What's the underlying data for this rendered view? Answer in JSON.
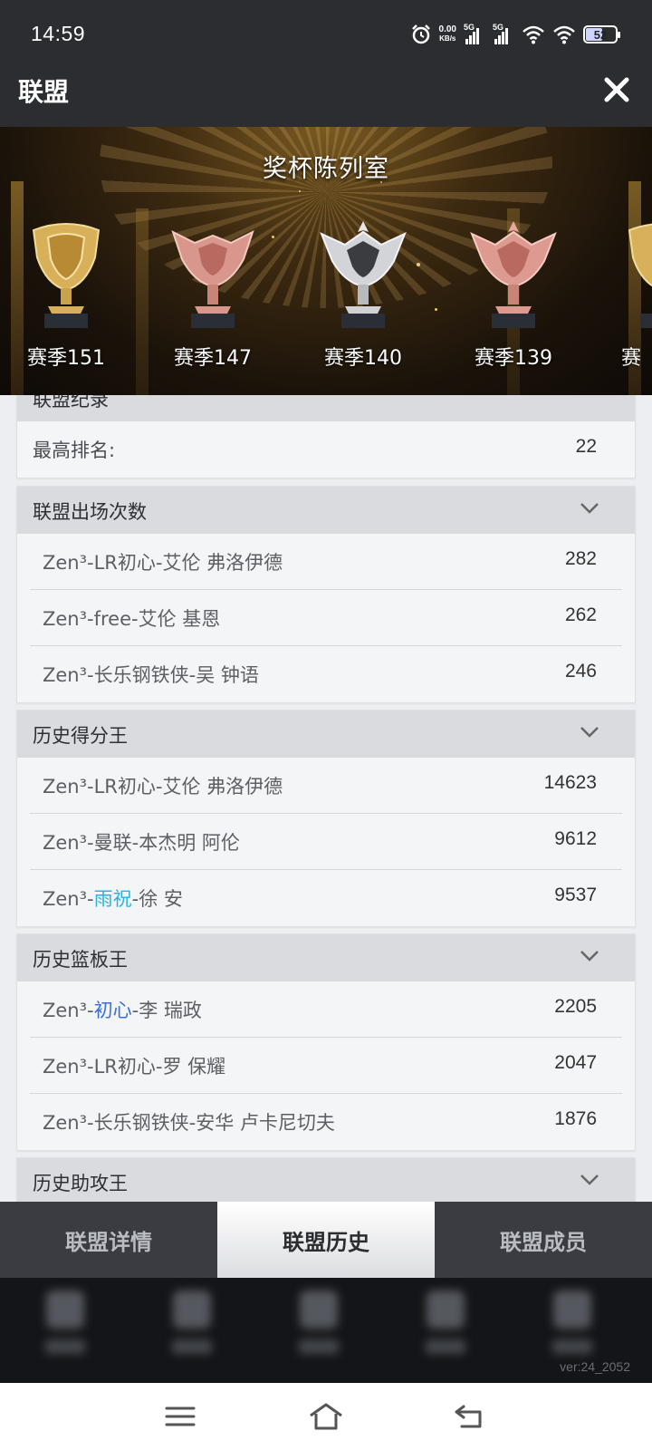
{
  "status": {
    "time": "14:59",
    "net_speed_top": "0.00",
    "net_speed_unit": "KB/s",
    "signal1_label": "5G",
    "signal2_label": "5G",
    "battery": "52",
    "icons": [
      "alarm-icon",
      "signal-icon",
      "wifi-icon",
      "battery-icon"
    ]
  },
  "header": {
    "title": "联盟",
    "close_icon": "close-icon"
  },
  "banner": {
    "title": "奖杯陈列室",
    "trophies": [
      {
        "label": "赛季151",
        "tier": "gold"
      },
      {
        "label": "赛季147",
        "tier": "rose"
      },
      {
        "label": "赛季140",
        "tier": "silver"
      },
      {
        "label": "赛季139",
        "tier": "rose"
      },
      {
        "label": "赛",
        "tier": "gold"
      }
    ]
  },
  "records": {
    "section_title": "联盟纪录",
    "best_rank_label": "最高排名:",
    "best_rank_value": "22"
  },
  "sections": [
    {
      "title": "联盟出场次数",
      "rows": [
        {
          "prefix": "Zen³-LR初心-艾伦 弗洛伊德",
          "value": "282"
        },
        {
          "prefix": "Zen³-free-艾伦 基恩",
          "value": "262"
        },
        {
          "prefix": "Zen³-长乐钢铁侠-吴 钟语",
          "value": "246"
        }
      ]
    },
    {
      "title": "历史得分王",
      "rows": [
        {
          "prefix": "Zen³-LR初心-艾伦 弗洛伊德",
          "value": "14623"
        },
        {
          "prefix": "Zen³-曼联-本杰明 阿伦",
          "value": "9612"
        },
        {
          "prefix": "Zen³-",
          "highlight": "雨祝",
          "suffix": "-徐 安",
          "value": "9537"
        }
      ]
    },
    {
      "title": "历史篮板王",
      "rows": [
        {
          "prefix": "Zen³-",
          "highlight": "初心",
          "suffix": "-李 瑞政",
          "value": "2205"
        },
        {
          "prefix": "Zen³-LR初心-罗 保耀",
          "value": "2047"
        },
        {
          "prefix": "Zen³-长乐钢铁侠-安华 卢卡尼切夫",
          "value": "1876"
        }
      ]
    },
    {
      "title": "历史助攻王",
      "rows": []
    }
  ],
  "tabs": [
    {
      "label": "联盟详情",
      "active": false
    },
    {
      "label": "联盟历史",
      "active": true
    },
    {
      "label": "联盟成员",
      "active": false
    }
  ],
  "version": "ver:24_2052",
  "colors": {
    "highlight_cyan": "#27b4e5",
    "highlight_blue": "#3a6fd8",
    "header_bg": "#2b2d31"
  }
}
